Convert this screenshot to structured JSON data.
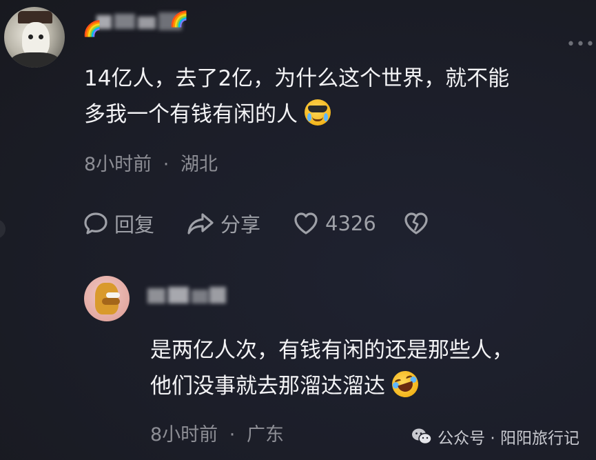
{
  "main_comment": {
    "avatar_icon": "snowman-avatar-icon",
    "username_badge_icon": "rainbow-icon",
    "text_line1": "14亿人，去了2亿，为什么这个世界，就不能",
    "text_line2": "多我一个有钱有闲的人",
    "emoji_icon": "crying-sunglasses-emoji",
    "time": "8小时前",
    "separator": "·",
    "location": "湖北",
    "more_icon": "more-dots-icon"
  },
  "actions": {
    "reply_label": "回复",
    "share_label": "分享",
    "like_count": "4326",
    "reply_icon": "speech-bubble-icon",
    "share_icon": "share-arrow-icon",
    "like_icon": "heart-icon",
    "dislike_icon": "broken-heart-icon"
  },
  "reply_comment": {
    "avatar_icon": "duck-avatar-icon",
    "text_line1": "是两亿人次，有钱有闲的还是那些人，",
    "text_line2": "他们没事就去那溜达溜达",
    "emoji_icon": "rolling-laughing-emoji",
    "time": "8小时前",
    "separator": "·",
    "location": "广东"
  },
  "watermark": {
    "icon": "wechat-icon",
    "text": "公众号 · 阳阳旅行记"
  },
  "colors": {
    "background": "#1d1f29",
    "text_primary": "#f3f3f5",
    "text_secondary": "#8d8e95",
    "action_text": "#9ea0a7"
  }
}
